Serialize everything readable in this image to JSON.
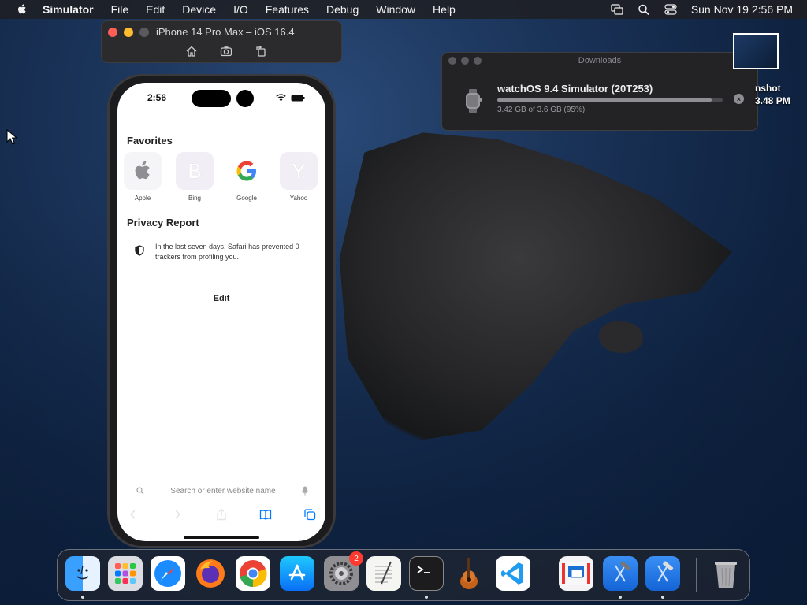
{
  "menubar": {
    "app_name": "Simulator",
    "items": [
      "File",
      "Edit",
      "Device",
      "I/O",
      "Features",
      "Debug",
      "Window",
      "Help"
    ],
    "clock": "Sun Nov 19  2:56 PM"
  },
  "simulator": {
    "title": "iPhone 14 Pro Max – iOS 16.4"
  },
  "phone": {
    "status_time": "2:56",
    "favorites_title": "Favorites",
    "favorites": [
      {
        "label": "Apple",
        "letter": "",
        "color": "#f5f5f7"
      },
      {
        "label": "Bing",
        "letter": "B",
        "color": "#f2eef6"
      },
      {
        "label": "Google",
        "letter": "",
        "color": "#ffffff"
      },
      {
        "label": "Yahoo",
        "letter": "Y",
        "color": "#f2eef6"
      }
    ],
    "privacy_title": "Privacy Report",
    "privacy_text": "In the last seven days, Safari has prevented 0 trackers from profiling you.",
    "edit_label": "Edit",
    "search_placeholder": "Search or enter website name"
  },
  "downloads": {
    "window_title": "Downloads",
    "item_name": "watchOS 9.4 Simulator (20T253)",
    "item_size": "3.42 GB of 3.6 GB (95%)",
    "progress": 0.95
  },
  "desktop_file": {
    "label_line1": "nshot",
    "label_line2": "3.48 PM"
  },
  "dock": {
    "apps": [
      "finder-icon",
      "launchpad-icon",
      "safari-icon",
      "firefox-icon",
      "chrome-icon",
      "app-store-icon",
      "system-settings-icon",
      "textedit-icon",
      "terminal-icon",
      "garageband-icon",
      "vscode-icon",
      "screens-icon",
      "xcode-icon",
      "xcode-beta-icon",
      "trash-icon"
    ],
    "settings_badge": "2"
  },
  "colors": {
    "traffic_red": "#ff5f57",
    "traffic_yellow": "#febc2e",
    "traffic_gray": "#5a5a5e",
    "safari_blue": "#007aff"
  }
}
